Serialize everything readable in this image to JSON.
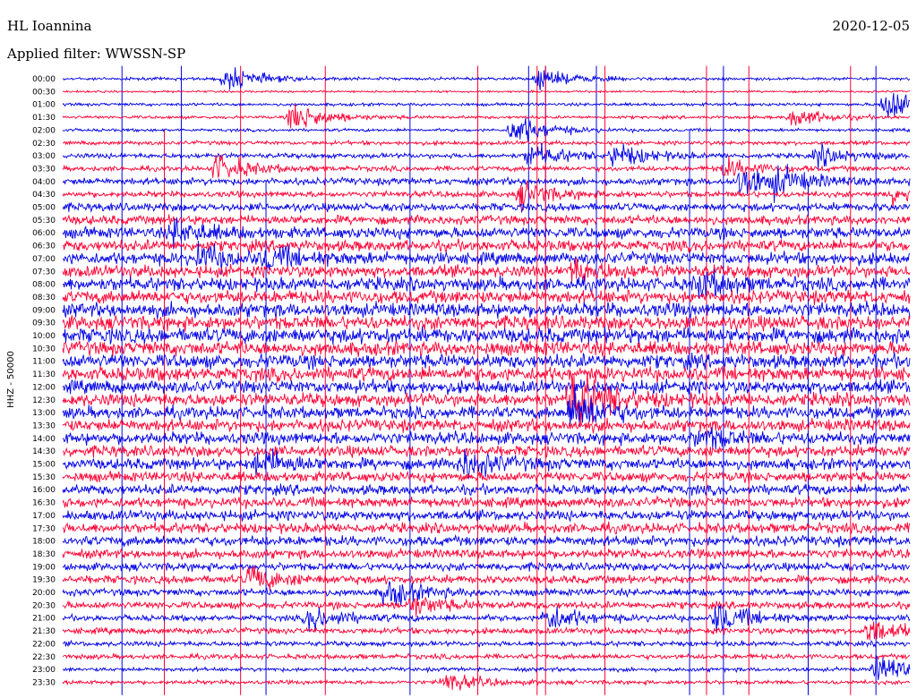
{
  "header": {
    "station": "HL Ioannina",
    "filter": "Applied filter: WWSSN-SP",
    "date": "2020-12-05"
  },
  "chart_data": {
    "type": "line",
    "title": "HL Ioannina",
    "subtitle": "Applied filter: WWSSN-SP",
    "date": "2020-12-05",
    "ylabel": "HHZ - 50000",
    "xlabel": "",
    "colors": [
      "#0000e6",
      "#ff0033"
    ],
    "row_labels": [
      "00:00",
      "00:30",
      "01:00",
      "01:30",
      "02:00",
      "02:30",
      "03:00",
      "03:30",
      "04:00",
      "04:30",
      "05:00",
      "05:30",
      "06:00",
      "06:30",
      "07:00",
      "07:30",
      "08:00",
      "08:30",
      "09:00",
      "09:30",
      "10:00",
      "10:30",
      "11:00",
      "11:30",
      "12:00",
      "12:30",
      "13:00",
      "13:30",
      "14:00",
      "14:30",
      "15:00",
      "15:30",
      "16:00",
      "16:30",
      "17:00",
      "17:30",
      "18:00",
      "18:30",
      "19:00",
      "19:30",
      "20:00",
      "20:30",
      "21:00",
      "21:30",
      "22:00",
      "22:30",
      "23:00",
      "23:30"
    ],
    "noise_level": [
      0.15,
      0.1,
      0.15,
      0.15,
      0.15,
      0.2,
      0.25,
      0.25,
      0.35,
      0.3,
      0.4,
      0.45,
      0.55,
      0.55,
      0.6,
      0.6,
      0.65,
      0.65,
      0.7,
      0.7,
      0.75,
      0.7,
      0.7,
      0.7,
      0.65,
      0.65,
      0.6,
      0.6,
      0.6,
      0.55,
      0.55,
      0.5,
      0.5,
      0.5,
      0.5,
      0.5,
      0.5,
      0.45,
      0.4,
      0.4,
      0.35,
      0.35,
      0.3,
      0.3,
      0.25,
      0.25,
      0.2,
      0.2
    ],
    "events": [
      {
        "row": 0,
        "position": 0.19,
        "strength": 0.6
      },
      {
        "row": 0,
        "position": 0.56,
        "strength": 0.5
      },
      {
        "row": 2,
        "position": 0.97,
        "strength": 1.0
      },
      {
        "row": 3,
        "position": 0.27,
        "strength": 0.8
      },
      {
        "row": 3,
        "position": 0.86,
        "strength": 0.5
      },
      {
        "row": 4,
        "position": 0.53,
        "strength": 0.8
      },
      {
        "row": 6,
        "position": 0.55,
        "strength": 0.6
      },
      {
        "row": 6,
        "position": 0.65,
        "strength": 0.6
      },
      {
        "row": 6,
        "position": 0.89,
        "strength": 0.5
      },
      {
        "row": 7,
        "position": 0.18,
        "strength": 0.7
      },
      {
        "row": 7,
        "position": 0.78,
        "strength": 0.5
      },
      {
        "row": 8,
        "position": 0.8,
        "strength": 0.8
      },
      {
        "row": 8,
        "position": 0.84,
        "strength": 0.5
      },
      {
        "row": 9,
        "position": 0.54,
        "strength": 0.6
      },
      {
        "row": 9,
        "position": 0.98,
        "strength": 0.5
      },
      {
        "row": 12,
        "position": 0.13,
        "strength": 0.6
      },
      {
        "row": 14,
        "position": 0.16,
        "strength": 0.6
      },
      {
        "row": 14,
        "position": 0.24,
        "strength": 0.5
      },
      {
        "row": 15,
        "position": 0.6,
        "strength": 0.5
      },
      {
        "row": 16,
        "position": 0.75,
        "strength": 0.6
      },
      {
        "row": 25,
        "position": 0.6,
        "strength": 1.6
      },
      {
        "row": 26,
        "position": 0.6,
        "strength": 1.1
      },
      {
        "row": 28,
        "position": 0.75,
        "strength": 0.5
      },
      {
        "row": 30,
        "position": 0.23,
        "strength": 0.7
      },
      {
        "row": 30,
        "position": 0.47,
        "strength": 0.7
      },
      {
        "row": 39,
        "position": 0.22,
        "strength": 0.6
      },
      {
        "row": 40,
        "position": 0.38,
        "strength": 0.7
      },
      {
        "row": 41,
        "position": 0.41,
        "strength": 0.5
      },
      {
        "row": 42,
        "position": 0.29,
        "strength": 0.6
      },
      {
        "row": 42,
        "position": 0.57,
        "strength": 0.7
      },
      {
        "row": 42,
        "position": 0.77,
        "strength": 0.8
      },
      {
        "row": 43,
        "position": 0.95,
        "strength": 0.6
      },
      {
        "row": 46,
        "position": 0.96,
        "strength": 0.7
      },
      {
        "row": 47,
        "position": 0.45,
        "strength": 0.5
      }
    ],
    "spikes": [
      {
        "position": 0.07,
        "rows": [
          0,
          47
        ]
      },
      {
        "position": 0.12,
        "rows": [
          5,
          47
        ]
      },
      {
        "position": 0.14,
        "rows": [
          0,
          14
        ]
      },
      {
        "position": 0.21,
        "rows": [
          0,
          47
        ]
      },
      {
        "position": 0.24,
        "rows": [
          9,
          47
        ]
      },
      {
        "position": 0.31,
        "rows": [
          0,
          47
        ]
      },
      {
        "position": 0.41,
        "rows": [
          3,
          47
        ]
      },
      {
        "position": 0.49,
        "rows": [
          0,
          47
        ]
      },
      {
        "position": 0.55,
        "rows": [
          0,
          12
        ]
      },
      {
        "position": 0.56,
        "rows": [
          0,
          47
        ]
      },
      {
        "position": 0.57,
        "rows": [
          0,
          18
        ]
      },
      {
        "position": 0.57,
        "rows": [
          0,
          47
        ]
      },
      {
        "position": 0.63,
        "rows": [
          0,
          18
        ]
      },
      {
        "position": 0.64,
        "rows": [
          0,
          47
        ]
      },
      {
        "position": 0.74,
        "rows": [
          5,
          47
        ]
      },
      {
        "position": 0.76,
        "rows": [
          0,
          47
        ]
      },
      {
        "position": 0.78,
        "rows": [
          0,
          47
        ]
      },
      {
        "position": 0.81,
        "rows": [
          0,
          47
        ]
      },
      {
        "position": 0.88,
        "rows": [
          9,
          47
        ]
      },
      {
        "position": 0.93,
        "rows": [
          0,
          47
        ]
      },
      {
        "position": 0.96,
        "rows": [
          0,
          47
        ]
      }
    ]
  }
}
